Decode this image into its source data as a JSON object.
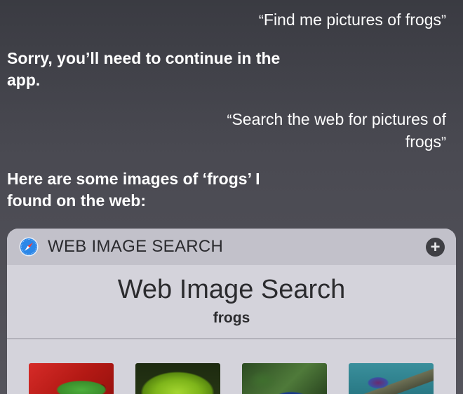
{
  "conversation": {
    "user_1": "Find me pictures of frogs",
    "assistant_1": "Sorry, you’ll need to continue in the app.",
    "user_2_line1": "Search the web for pictures of",
    "user_2_line2": "frogs",
    "assistant_2": "Here are some images of ‘frogs’ I found on the web:",
    "quote_open": "“",
    "quote_close": "”"
  },
  "card": {
    "header_title": "WEB IMAGE SEARCH",
    "header_icon": "safari-compass-icon",
    "add_icon": "plus-icon",
    "add_glyph": "+",
    "title": "Web Image Search",
    "query": "frogs",
    "thumbnails": [
      {
        "subject": "red-eyed tree frog"
      },
      {
        "subject": "green frog close-up"
      },
      {
        "subject": "blue poison dart frog"
      },
      {
        "subject": "frog on branch"
      }
    ]
  },
  "colors": {
    "background_top": "#3a3b42",
    "card_body": "#d4d3db",
    "card_header": "#c2c1ca",
    "text_dark": "#2b2b2e",
    "text_light": "#ffffff"
  }
}
